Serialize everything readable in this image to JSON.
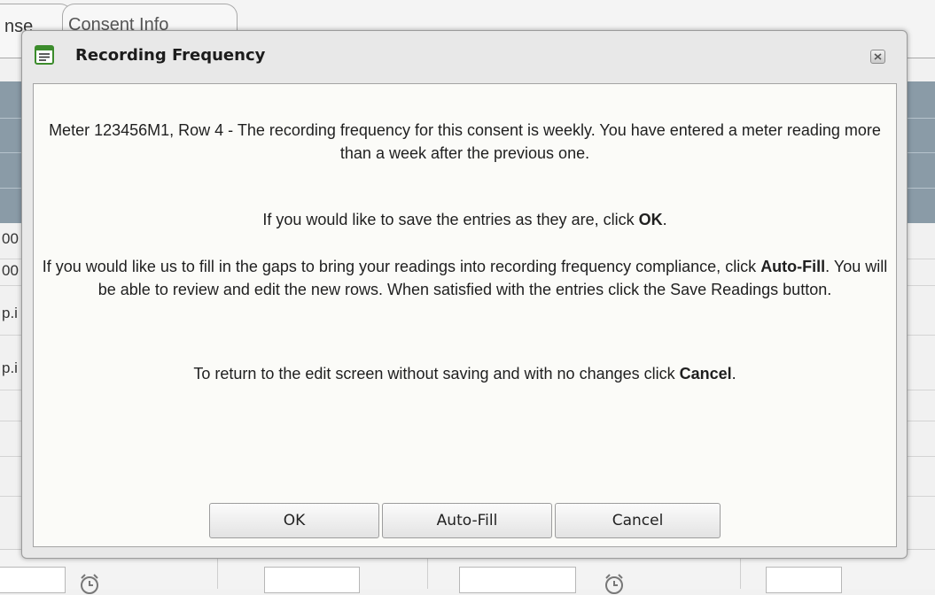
{
  "background": {
    "tabs": [
      {
        "label": "nse"
      },
      {
        "label": "Consent Info"
      }
    ],
    "cells": [
      "00",
      "00",
      "p.i",
      "p.i"
    ]
  },
  "dialog": {
    "title": "Recording Frequency",
    "paragraph1": "Meter 123456M1, Row 4 - The recording frequency for this consent is weekly. You have entered a meter reading more than a week after the previous one.",
    "paragraph2": {
      "before": "If you would like to save the entries as they are, click ",
      "bold": "OK",
      "after": "."
    },
    "paragraph3": {
      "before": "If you would like us to fill in the gaps to bring your readings into recording frequency compliance, click ",
      "bold": "Auto-Fill",
      "after": ". You will be able to review and edit the new rows. When satisfied with the entries click the Save Readings button."
    },
    "paragraph4": {
      "before": "To return to the edit screen without saving and with no changes click ",
      "bold": "Cancel",
      "after": "."
    },
    "buttons": {
      "ok": "OK",
      "autofill": "Auto-Fill",
      "cancel": "Cancel"
    }
  },
  "icons": {
    "title": "window-icon",
    "close": "close-icon",
    "clock": "alarm-clock-icon"
  },
  "colors": {
    "header_band": "#8a9ba7",
    "dialog_body": "#fbfbf8",
    "icon_green": "#3c8c2c"
  }
}
